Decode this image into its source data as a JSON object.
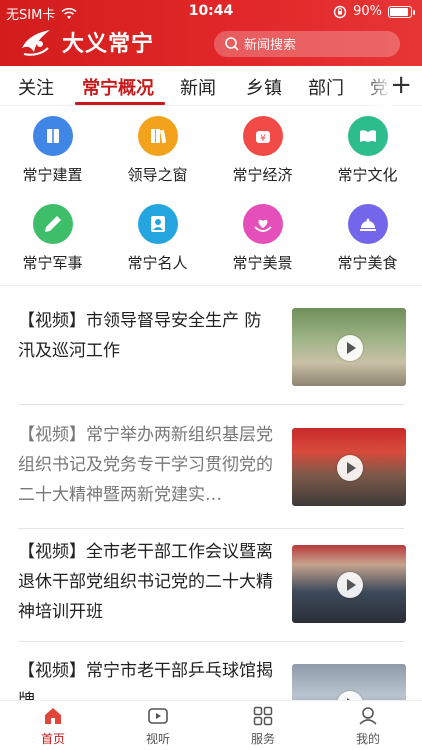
{
  "status_bar": {
    "carrier": "无SIM卡",
    "time": "10:44",
    "battery": "90%"
  },
  "header": {
    "app_name": "大义常宁",
    "search_placeholder": "新闻搜索"
  },
  "tabs": {
    "items": [
      "关注",
      "常宁概况",
      "新闻",
      "乡镇",
      "部门",
      "党"
    ],
    "active": "常宁概况",
    "add_label": "+"
  },
  "categories": [
    {
      "label": "常宁建置",
      "icon": "book-icon",
      "color": "#3f86e6"
    },
    {
      "label": "领导之窗",
      "icon": "books-icon",
      "color": "#f3a21c"
    },
    {
      "label": "常宁经济",
      "icon": "money-icon",
      "color": "#f24a46"
    },
    {
      "label": "常宁文化",
      "icon": "open-book-icon",
      "color": "#2dbd8c"
    },
    {
      "label": "常宁军事",
      "icon": "pen-icon",
      "color": "#3fbe6a"
    },
    {
      "label": "常宁名人",
      "icon": "profile-icon",
      "color": "#25a5e0"
    },
    {
      "label": "常宁美景",
      "icon": "heart-hands-icon",
      "color": "#e44fb9"
    },
    {
      "label": "常宁美食",
      "icon": "cloche-icon",
      "color": "#7466ea"
    }
  ],
  "news": [
    {
      "title": "【视频】市领导督导安全生产 防汛及巡河工作",
      "read": false
    },
    {
      "title": "【视频】常宁举办两新组织基层党组织书记及党务专干学习贯彻党的二十大精神暨两新党建实…",
      "read": true
    },
    {
      "title": "【视频】全市老干部工作会议暨离退休干部党组织书记党的二十大精神培训开班",
      "read": false
    },
    {
      "title": "【视频】常宁市老干部乒乓球馆揭牌",
      "read": false
    }
  ],
  "bottom_nav": [
    {
      "label": "首页",
      "icon": "home-icon",
      "active": true
    },
    {
      "label": "视听",
      "icon": "video-icon",
      "active": false
    },
    {
      "label": "服务",
      "icon": "grid-icon",
      "active": false
    },
    {
      "label": "我的",
      "icon": "user-icon",
      "active": false
    }
  ]
}
